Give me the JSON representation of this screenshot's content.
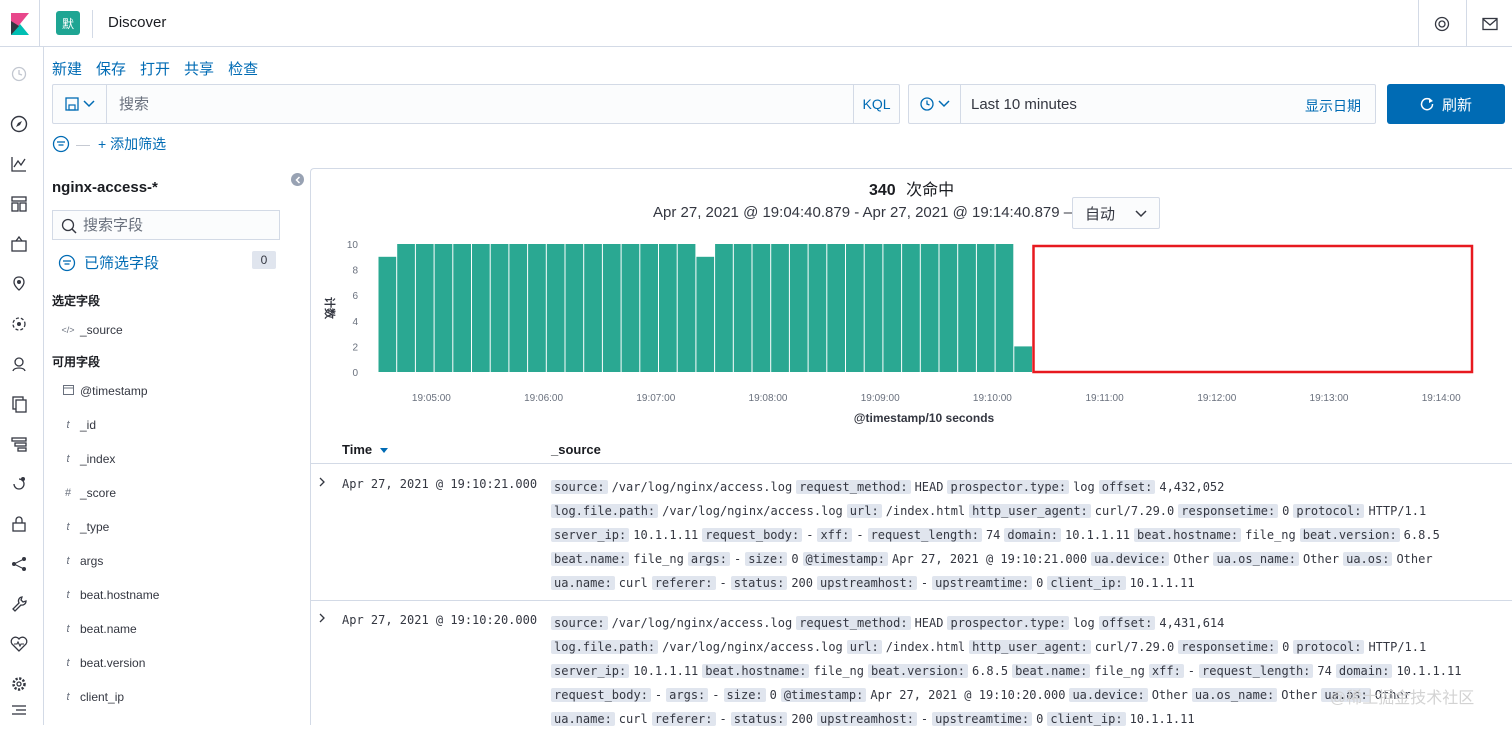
{
  "app": {
    "space_initial": "默",
    "title": "Discover"
  },
  "menu": {
    "items": [
      "新建",
      "保存",
      "打开",
      "共享",
      "检查"
    ]
  },
  "query": {
    "placeholder": "搜索",
    "language": "KQL"
  },
  "time_picker": {
    "value": "Last 10 minutes",
    "show_dates": "显示日期",
    "refresh_label": "刷新"
  },
  "filters": {
    "add_label": "+ 添加筛选"
  },
  "sidebar": {
    "index_pattern": "nginx-access-*",
    "field_search_placeholder": "搜索字段",
    "filtered_fields_label": "已筛选字段",
    "filtered_fields_count": "0",
    "selected_title": "选定字段",
    "selected_fields": [
      {
        "type": "</>",
        "name": "_source"
      }
    ],
    "available_title": "可用字段",
    "available_fields": [
      {
        "type": "cal",
        "name": "@timestamp"
      },
      {
        "type": "t",
        "name": "_id"
      },
      {
        "type": "t",
        "name": "_index"
      },
      {
        "type": "#",
        "name": "_score"
      },
      {
        "type": "t",
        "name": "_type"
      },
      {
        "type": "t",
        "name": "args"
      },
      {
        "type": "t",
        "name": "beat.hostname"
      },
      {
        "type": "t",
        "name": "beat.name"
      },
      {
        "type": "t",
        "name": "beat.version"
      },
      {
        "type": "t",
        "name": "client_ip"
      }
    ]
  },
  "histogram": {
    "hits": "340",
    "hits_label": "次命中",
    "range": "Apr 27, 2021 @ 19:04:40.879 - Apr 27, 2021 @ 19:14:40.879 —",
    "interval": "自动"
  },
  "chart_data": {
    "type": "bar",
    "xlabel": "@timestamp/10 seconds",
    "ylabel": "计数",
    "ylim": [
      0,
      10
    ],
    "y_ticks": [
      0,
      2,
      4,
      6,
      8,
      10
    ],
    "x_tick_labels": [
      "19:05:00",
      "19:06:00",
      "19:07:00",
      "19:08:00",
      "19:09:00",
      "19:10:00",
      "19:11:00",
      "19:12:00",
      "19:13:00",
      "19:14:00"
    ],
    "bar_color": "#2aa892",
    "highlight_color": "#e7191f",
    "values": [
      9,
      10,
      10,
      10,
      10,
      10,
      10,
      10,
      10,
      10,
      10,
      10,
      10,
      10,
      10,
      10,
      10,
      9,
      10,
      10,
      10,
      10,
      10,
      10,
      10,
      10,
      10,
      10,
      10,
      10,
      10,
      10,
      10,
      10,
      2
    ]
  },
  "table": {
    "col_time": "Time",
    "col_source": "_source",
    "rows": [
      {
        "time": "Apr 27, 2021 @ 19:10:21.000",
        "fields": [
          [
            "source:",
            "/var/log/nginx/access.log"
          ],
          [
            "request_method:",
            "HEAD"
          ],
          [
            "prospector.type:",
            "log"
          ],
          [
            "offset:",
            "4,432,052"
          ],
          [
            "log.file.path:",
            "/var/log/nginx/access.log"
          ],
          [
            "url:",
            "/index.html"
          ],
          [
            "http_user_agent:",
            "curl/7.29.0"
          ],
          [
            "responsetime:",
            "0"
          ],
          [
            "protocol:",
            "HTTP/1.1"
          ],
          [
            "server_ip:",
            "10.1.1.11"
          ],
          [
            "request_body:",
            "-"
          ],
          [
            "xff:",
            "-"
          ],
          [
            "request_length:",
            "74"
          ],
          [
            "domain:",
            "10.1.1.11"
          ],
          [
            "beat.hostname:",
            "file_ng"
          ],
          [
            "beat.version:",
            "6.8.5"
          ],
          [
            "beat.name:",
            "file_ng"
          ],
          [
            "args:",
            "-"
          ],
          [
            "size:",
            "0"
          ],
          [
            "@timestamp:",
            "Apr 27, 2021 @ 19:10:21.000"
          ],
          [
            "ua.device:",
            "Other"
          ],
          [
            "ua.os_name:",
            "Other"
          ],
          [
            "ua.os:",
            "Other"
          ],
          [
            "ua.name:",
            "curl"
          ],
          [
            "referer:",
            "-"
          ],
          [
            "status:",
            "200"
          ],
          [
            "upstreamhost:",
            "-"
          ],
          [
            "upstreamtime:",
            "0"
          ],
          [
            "client_ip:",
            "10.1.1.11"
          ]
        ]
      },
      {
        "time": "Apr 27, 2021 @ 19:10:20.000",
        "fields": [
          [
            "source:",
            "/var/log/nginx/access.log"
          ],
          [
            "request_method:",
            "HEAD"
          ],
          [
            "prospector.type:",
            "log"
          ],
          [
            "offset:",
            "4,431,614"
          ],
          [
            "log.file.path:",
            "/var/log/nginx/access.log"
          ],
          [
            "url:",
            "/index.html"
          ],
          [
            "http_user_agent:",
            "curl/7.29.0"
          ],
          [
            "responsetime:",
            "0"
          ],
          [
            "protocol:",
            "HTTP/1.1"
          ],
          [
            "server_ip:",
            "10.1.1.11"
          ],
          [
            "beat.hostname:",
            "file_ng"
          ],
          [
            "beat.version:",
            "6.8.5"
          ],
          [
            "beat.name:",
            "file_ng"
          ],
          [
            "xff:",
            "-"
          ],
          [
            "request_length:",
            "74"
          ],
          [
            "domain:",
            "10.1.1.11"
          ],
          [
            "request_body:",
            "-"
          ],
          [
            "args:",
            "-"
          ],
          [
            "size:",
            "0"
          ],
          [
            "@timestamp:",
            "Apr 27, 2021 @ 19:10:20.000"
          ],
          [
            "ua.device:",
            "Other"
          ],
          [
            "ua.os_name:",
            "Other"
          ],
          [
            "ua.os:",
            "Other"
          ],
          [
            "ua.name:",
            "curl"
          ],
          [
            "referer:",
            "-"
          ],
          [
            "status:",
            "200"
          ],
          [
            "upstreamhost:",
            "-"
          ],
          [
            "upstreamtime:",
            "0"
          ],
          [
            "client_ip:",
            "10.1.1.11"
          ]
        ]
      }
    ]
  },
  "watermark": "@稀土掘金技术社区"
}
